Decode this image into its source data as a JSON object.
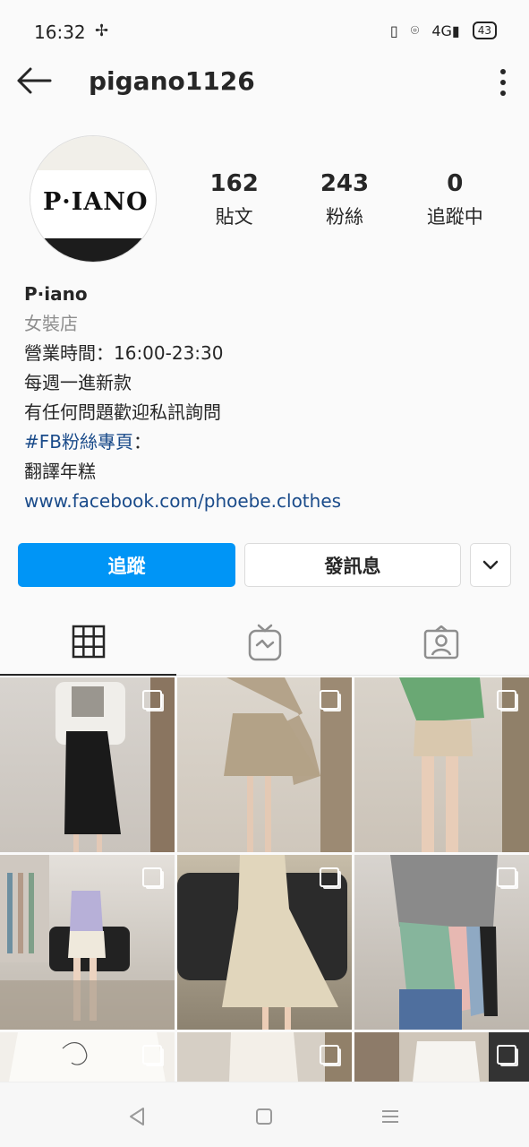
{
  "status_bar": {
    "time": "16:32",
    "network": "4G",
    "battery": "43"
  },
  "header": {
    "username": "pigano1126"
  },
  "profile": {
    "avatar_text": "P·IANO",
    "stats": [
      {
        "value": "162",
        "label": "貼文"
      },
      {
        "value": "243",
        "label": "粉絲"
      },
      {
        "value": "0",
        "label": "追蹤中"
      }
    ],
    "bio": {
      "name": "P·iano",
      "category": "女裝店",
      "lines": [
        "營業時間：16:00-23:30",
        "每週一進新款",
        "有任何問題歡迎私訊詢問"
      ],
      "hashtag": "#FB粉絲專頁",
      "hashtag_suffix": "：",
      "extra": "翻譯年糕",
      "link": "www.facebook.com/phoebe.clothes"
    }
  },
  "actions": {
    "follow_label": "追蹤",
    "message_label": "發訊息"
  },
  "tabs": [
    {
      "icon": "grid-icon",
      "active": true
    },
    {
      "icon": "igtv-icon",
      "active": false
    },
    {
      "icon": "tagged-icon",
      "active": false
    }
  ],
  "colors": {
    "primary": "#0095f6",
    "link": "#1a4b8a",
    "muted": "#8e8e8e"
  }
}
